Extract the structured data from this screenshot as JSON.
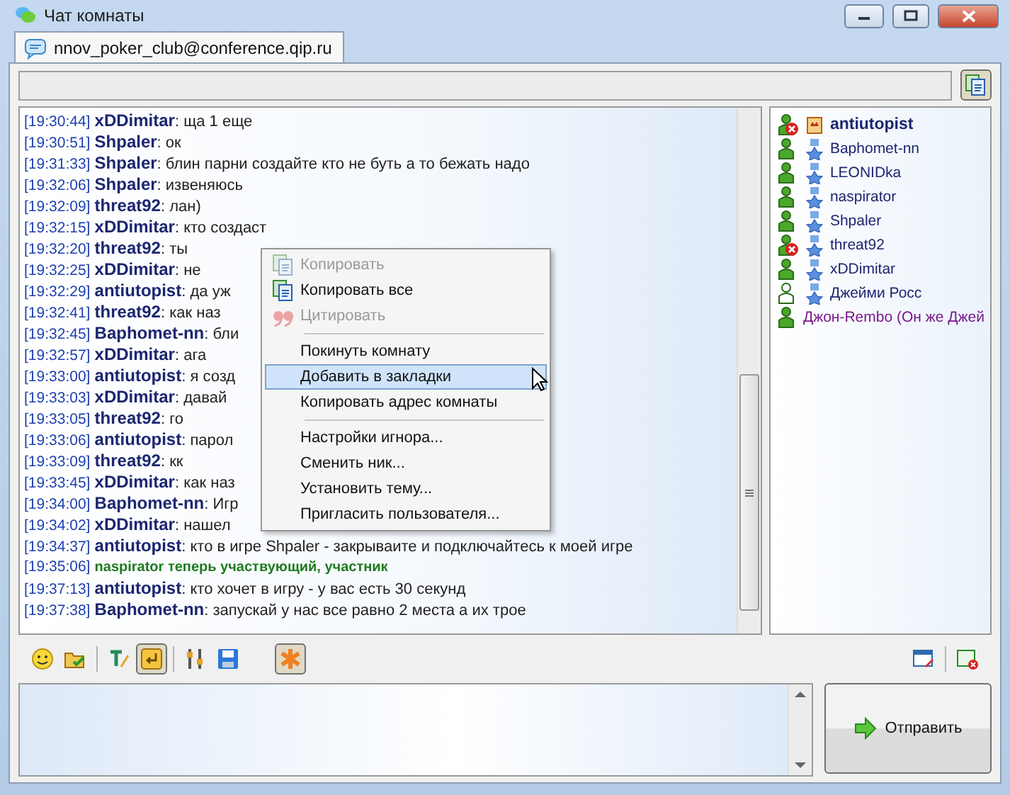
{
  "window": {
    "title": "Чат комнаты"
  },
  "tabs": [
    {
      "label": "nnov_poker_club@conference.qip.ru",
      "selected": true
    }
  ],
  "messages": [
    {
      "kind": "chat",
      "time": "[19:30:44]",
      "nick": "xDDimitar",
      "text": ": ща 1 еще"
    },
    {
      "kind": "chat",
      "time": "[19:30:51]",
      "nick": "Shpaler",
      "text": ": ок"
    },
    {
      "kind": "chat",
      "time": "[19:31:33]",
      "nick": "Shpaler",
      "text": ": блин парни создайте кто не буть а то бежать надо"
    },
    {
      "kind": "chat",
      "time": "[19:32:06]",
      "nick": "Shpaler",
      "text": ": извеняюсь"
    },
    {
      "kind": "chat",
      "time": "[19:32:09]",
      "nick": "threat92",
      "text": ": лан)"
    },
    {
      "kind": "chat",
      "time": "[19:32:15]",
      "nick": "xDDimitar",
      "text": ": кто создаст"
    },
    {
      "kind": "chat",
      "time": "[19:32:20]",
      "nick": "threat92",
      "text": ": ты"
    },
    {
      "kind": "chat",
      "time": "[19:32:25]",
      "nick": "xDDimitar",
      "text": ": не"
    },
    {
      "kind": "chat",
      "time": "[19:32:29]",
      "nick": "antiutopist",
      "text": ": да уж"
    },
    {
      "kind": "chat",
      "time": "[19:32:41]",
      "nick": "threat92",
      "text": ": как наз"
    },
    {
      "kind": "chat",
      "time": "[19:32:45]",
      "nick": "Baphomet-nn",
      "text": ": бли"
    },
    {
      "kind": "chat",
      "time": "[19:32:57]",
      "nick": "xDDimitar",
      "text": ": ага"
    },
    {
      "kind": "chat",
      "time": "[19:33:00]",
      "nick": "antiutopist",
      "text": ": я созд"
    },
    {
      "kind": "chat",
      "time": "[19:33:03]",
      "nick": "xDDimitar",
      "text": ": давай"
    },
    {
      "kind": "chat",
      "time": "[19:33:05]",
      "nick": "threat92",
      "text": ": го"
    },
    {
      "kind": "chat",
      "time": "[19:33:06]",
      "nick": "antiutopist",
      "text": ": парол"
    },
    {
      "kind": "chat",
      "time": "[19:33:09]",
      "nick": "threat92",
      "text": ": кк"
    },
    {
      "kind": "chat",
      "time": "[19:33:45]",
      "nick": "xDDimitar",
      "text": ": как наз"
    },
    {
      "kind": "chat",
      "time": "[19:34:00]",
      "nick": "Baphomet-nn",
      "text": ": Игр"
    },
    {
      "kind": "chat",
      "time": "[19:34:02]",
      "nick": "xDDimitar",
      "text": ": нашел"
    },
    {
      "kind": "chat",
      "time": "[19:34:37]",
      "nick": "antiutopist",
      "text": ": кто в игре Shpaler - закрываите и подключайтесь к моей игре"
    },
    {
      "kind": "system",
      "time": "[19:35:06]",
      "text": "naspirator теперь участвующий, участник"
    },
    {
      "kind": "chat",
      "time": "[19:37:13]",
      "nick": "antiutopist",
      "text": ": кто хочет в игру - у вас есть 30 секунд"
    },
    {
      "kind": "chat",
      "time": "[19:37:38]",
      "nick": "Baphomet-nn",
      "text": ": запускай у нас все равно 2 места а их трое"
    }
  ],
  "context_menu": [
    {
      "kind": "copy",
      "label": "Копировать",
      "disabled": true,
      "selected": false
    },
    {
      "kind": "copy",
      "label": "Копировать все",
      "disabled": false,
      "selected": false
    },
    {
      "kind": "quote",
      "label": "Цитировать",
      "disabled": true,
      "selected": false
    },
    {
      "kind": "separator"
    },
    {
      "kind": "plain",
      "label": "Покинуть комнату",
      "disabled": false,
      "selected": false
    },
    {
      "kind": "plain",
      "label": "Добавить в закладки",
      "disabled": false,
      "selected": true
    },
    {
      "kind": "plain",
      "label": "Копировать адрес комнаты",
      "disabled": false,
      "selected": false
    },
    {
      "kind": "separator"
    },
    {
      "kind": "plain",
      "label": "Настройки игнора...",
      "disabled": false,
      "selected": false
    },
    {
      "kind": "plain",
      "label": "Сменить ник...",
      "disabled": false,
      "selected": false
    },
    {
      "kind": "plain",
      "label": "Установить тему...",
      "disabled": false,
      "selected": false
    },
    {
      "kind": "plain",
      "label": "Пригласить пользователя...",
      "disabled": false,
      "selected": false
    }
  ],
  "participants": [
    {
      "kind": "owner",
      "name": "antiutopist",
      "busy": true,
      "inactive": false
    },
    {
      "kind": "member",
      "name": "Baphomet-nn",
      "busy": false,
      "inactive": false
    },
    {
      "kind": "member",
      "name": "LEONIDka",
      "busy": false,
      "inactive": false
    },
    {
      "kind": "member",
      "name": "naspirator",
      "busy": false,
      "inactive": false
    },
    {
      "kind": "member",
      "name": "Shpaler",
      "busy": false,
      "inactive": false
    },
    {
      "kind": "member",
      "name": "threat92",
      "busy": true,
      "inactive": false
    },
    {
      "kind": "member",
      "name": "xDDimitar",
      "busy": false,
      "inactive": false
    },
    {
      "kind": "member",
      "name": "Джейми Росс",
      "busy": false,
      "inactive": true
    },
    {
      "kind": "visitor",
      "name": "Джон-Rembo (Он же Джей",
      "busy": false,
      "inactive": false
    }
  ],
  "send_button": {
    "label": "Отправить"
  }
}
